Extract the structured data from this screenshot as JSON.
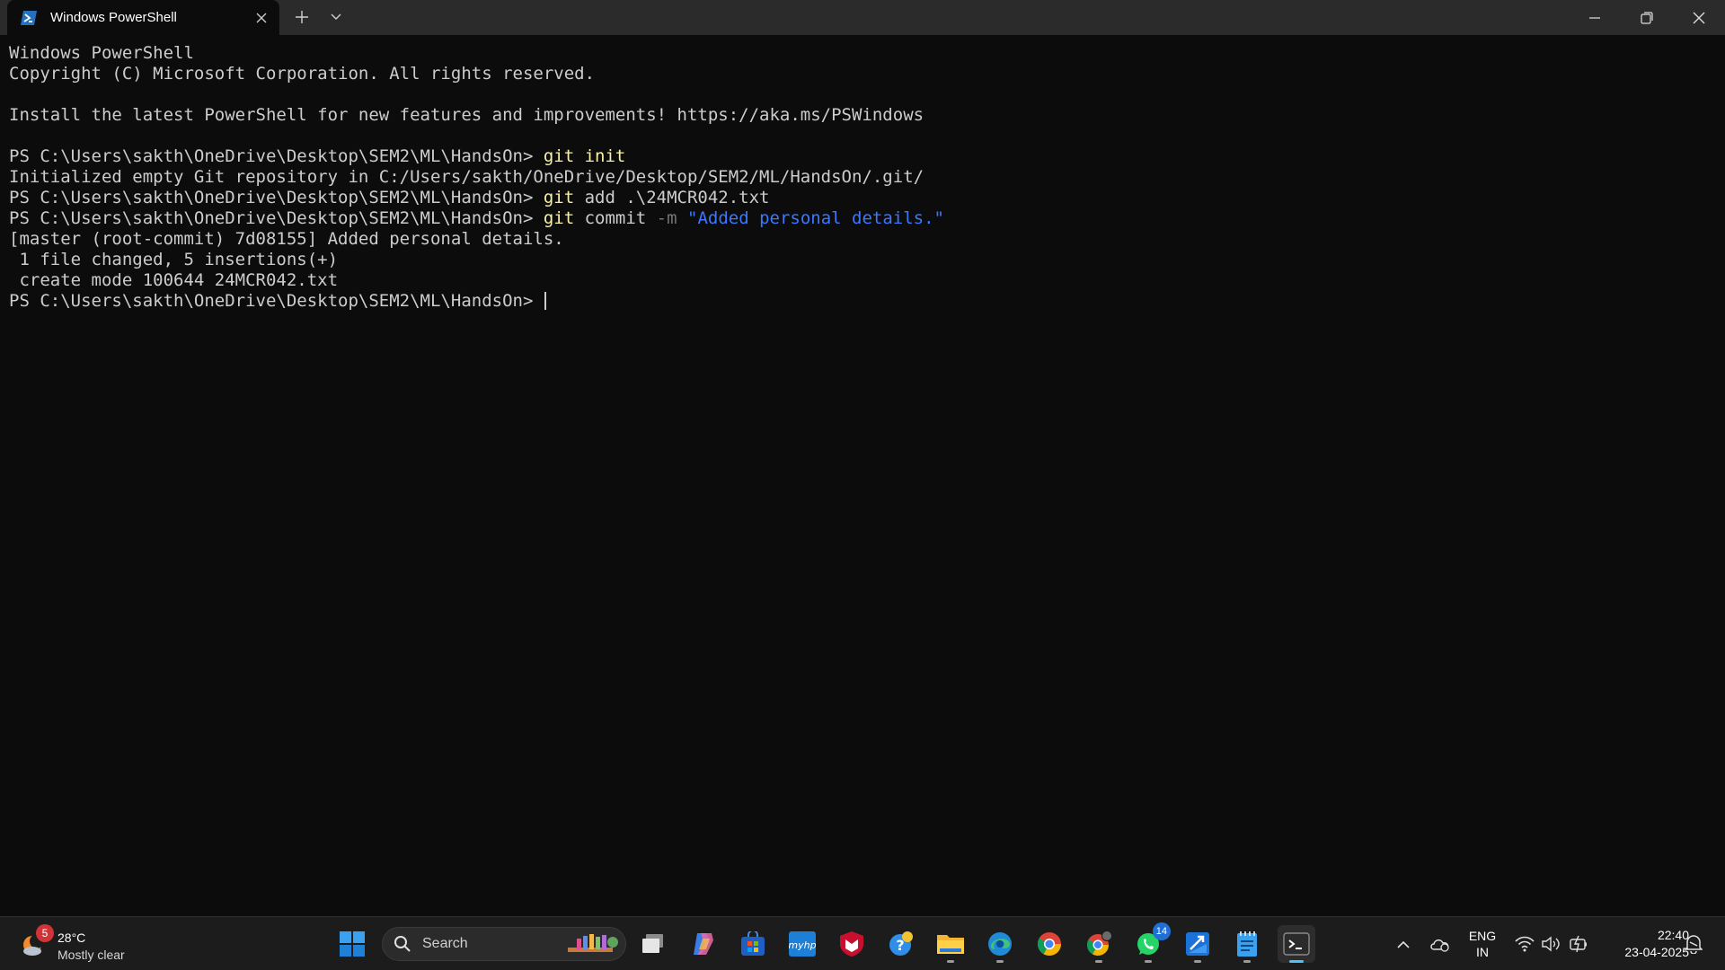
{
  "window": {
    "tab_title": "Windows PowerShell"
  },
  "terminal": {
    "lines": [
      "Windows PowerShell",
      "Copyright (C) Microsoft Corporation. All rights reserved.",
      "",
      "Install the latest PowerShell for new features and improvements! https://aka.ms/PSWindows",
      ""
    ],
    "prompt": "PS C:\\Users\\sakth\\OneDrive\\Desktop\\SEM2\\ML\\HandsOn> ",
    "cmd1": "git init",
    "out1": "Initialized empty Git repository in C:/Users/sakth/OneDrive/Desktop/SEM2/ML/HandsOn/.git/",
    "cmd2_git": "git",
    "cmd2_rest": " add .\\24MCR042.txt",
    "cmd3_git": "git",
    "cmd3_sub": " commit ",
    "cmd3_flag": "-m",
    "cmd3_str": " \"Added personal details.\"",
    "out3": [
      "[master (root-commit) 7d08155] Added personal details.",
      " 1 file changed, 5 insertions(+)",
      " create mode 100644 24MCR042.txt"
    ]
  },
  "taskbar": {
    "weather": {
      "temp": "28°C",
      "desc": "Mostly clear",
      "badge": "5"
    },
    "search_placeholder": "Search",
    "whatsapp_badge": "14",
    "lang_top": "ENG",
    "lang_bottom": "IN",
    "time": "22:40",
    "date": "23-04-2025"
  },
  "colors": {
    "background": "#0c0c0c",
    "titlebar": "#2b2b2b",
    "taskbar": "#1c1c1c",
    "command": "#f9f1a5",
    "string": "#3b78ff",
    "accent": "#4cc2ff"
  }
}
